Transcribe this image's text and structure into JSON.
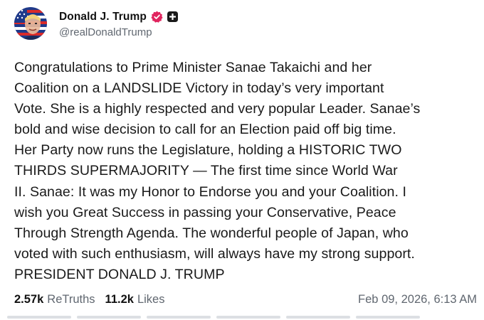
{
  "author": {
    "display_name": "Donald J. Trump",
    "handle": "@realDonaldTrump",
    "avatar_icon": "flag-portrait-avatar",
    "verified_icon": "verified-check-icon",
    "verified_color": "#e0245e",
    "badge_icon": "plus-badge-icon"
  },
  "post": {
    "text": "Congratulations to Prime Minister Sanae Takaichi and her\nCoalition on a LANDSLIDE Victory in today’s very important\nVote. She is a highly respected and very popular Leader. Sanae’s\nbold and wise decision to call for an Election paid off big time.\nHer Party now runs the Legislature, holding a HISTORIC TWO\nTHIRDS SUPERMAJORITY — The first time since World War\nII. Sanae: It was my Honor to Endorse you and your Coalition. I\nwish you Great Success in passing your Conservative, Peace\nThrough Strength Agenda. The wonderful people of Japan, who\nvoted with such enthusiasm, will always have my strong support.\nPRESIDENT DONALD J. TRUMP"
  },
  "stats": {
    "retruths_count": "2.57k",
    "retruths_label": "ReTruths",
    "likes_count": "11.2k",
    "likes_label": "Likes"
  },
  "timestamp": "Feb 09, 2026, 6:13 AM"
}
